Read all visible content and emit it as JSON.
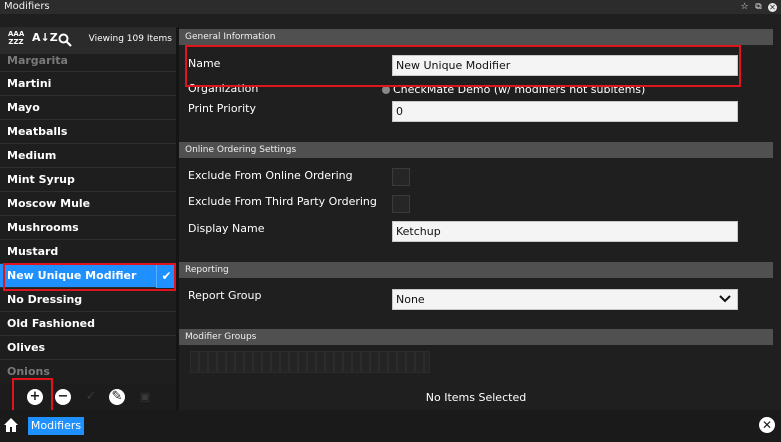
{
  "window": {
    "title": "Modifiers"
  },
  "title_buttons": {
    "star": "☆",
    "restore": "⧉",
    "close": "✕"
  },
  "left_panel": {
    "viewing_text": "Viewing 109 Items",
    "sort_alpha_label": "AAA\nZZZ",
    "sort_az_label": "A↓Z",
    "items": [
      {
        "label": "Margarita",
        "state": "faded"
      },
      {
        "label": "Martini",
        "state": "normal"
      },
      {
        "label": "Mayo",
        "state": "normal"
      },
      {
        "label": "Meatballs",
        "state": "normal"
      },
      {
        "label": "Medium",
        "state": "normal"
      },
      {
        "label": "Mint Syrup",
        "state": "normal"
      },
      {
        "label": "Moscow Mule",
        "state": "normal"
      },
      {
        "label": "Mushrooms",
        "state": "normal"
      },
      {
        "label": "Mustard",
        "state": "normal"
      },
      {
        "label": "New Unique Modifier",
        "state": "selected"
      },
      {
        "label": "No Dressing",
        "state": "normal"
      },
      {
        "label": "Old Fashioned",
        "state": "normal"
      },
      {
        "label": "Olives",
        "state": "normal"
      },
      {
        "label": "Onions",
        "state": "faded"
      }
    ],
    "buttons": {
      "add": "+",
      "remove": "−",
      "confirm": "✓",
      "edit": "✎"
    }
  },
  "sections": {
    "general": {
      "header": "General Information",
      "name_label": "Name",
      "name_value": "New Unique Modifier",
      "org_label": "Organization",
      "org_value": "CheckMate Demo (w/ modifiers not subitems)",
      "priority_label": "Print Priority",
      "priority_value": "0"
    },
    "online": {
      "header": "Online Ordering Settings",
      "exclude_online_label": "Exclude From Online Ordering",
      "exclude_third_label": "Exclude From Third Party Ordering",
      "display_name_label": "Display Name",
      "display_name_value": "Ketchup"
    },
    "reporting": {
      "header": "Reporting",
      "report_group_label": "Report Group",
      "report_group_value": "None"
    },
    "groups": {
      "header": "Modifier Groups"
    }
  },
  "status": {
    "no_items": "No Items Selected"
  },
  "bottom_bar": {
    "tab_label": "Modifiers",
    "close": "✕"
  },
  "colors": {
    "accent": "#1e90ff",
    "highlight": "#e0141c",
    "section": "#505050",
    "background": "#1f1f1f"
  }
}
